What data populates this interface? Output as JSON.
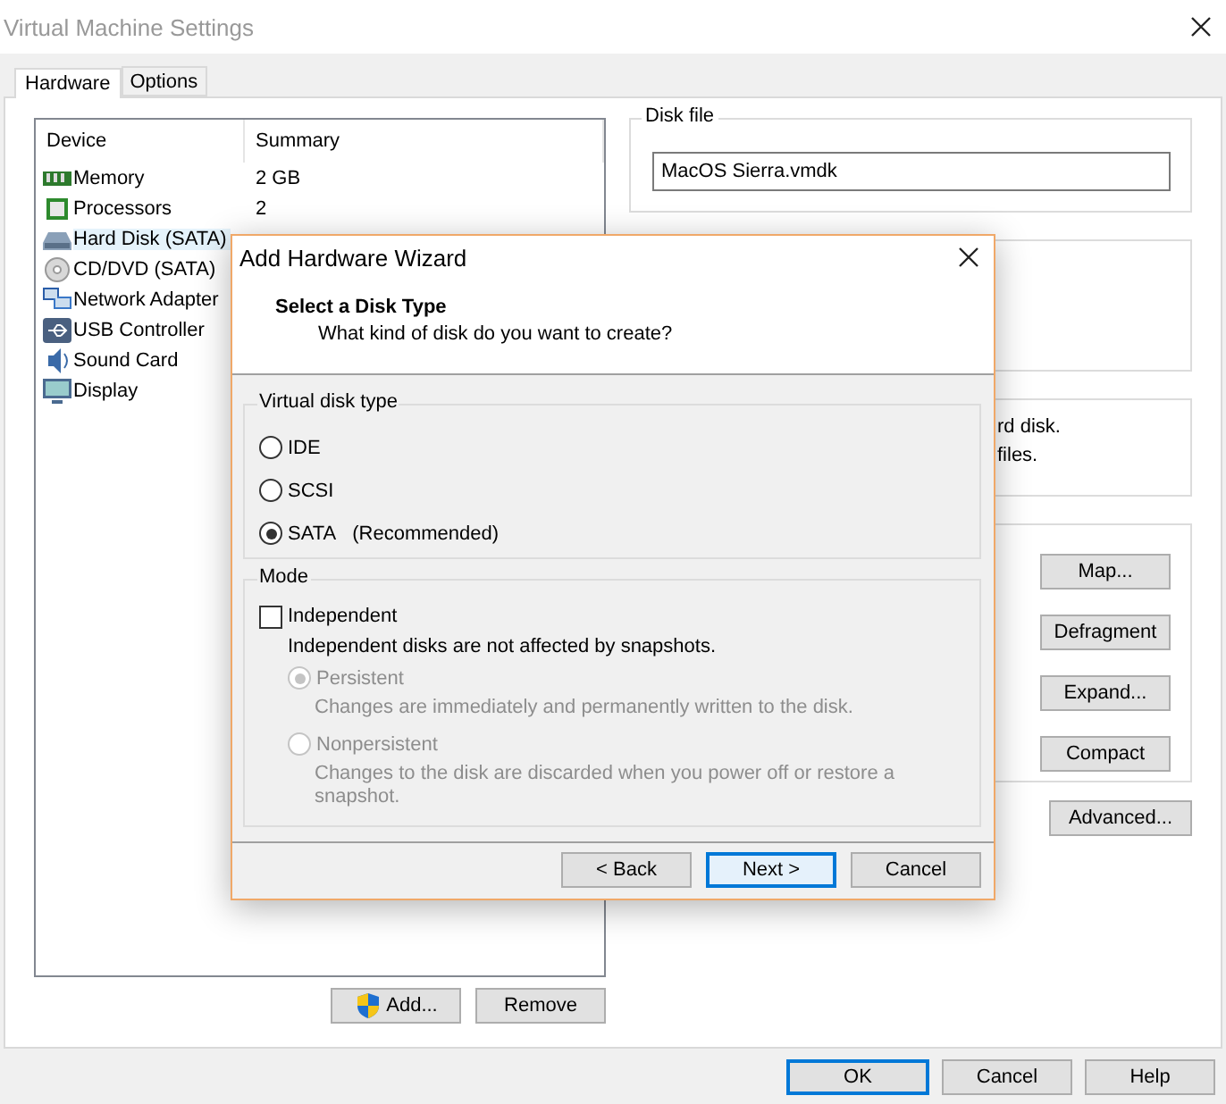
{
  "window": {
    "title": "Virtual Machine Settings"
  },
  "tabs": [
    {
      "label": "Hardware",
      "selected": true
    },
    {
      "label": "Options",
      "selected": false
    }
  ],
  "devices": {
    "columns": [
      "Device",
      "Summary"
    ],
    "rows": [
      {
        "kind": "memory",
        "name": "Memory",
        "summary": "2 GB",
        "selected": false
      },
      {
        "kind": "processor",
        "name": "Processors",
        "summary": "2",
        "selected": false
      },
      {
        "kind": "disk",
        "name": "Hard Disk (SATA)",
        "selected": true
      },
      {
        "kind": "cd",
        "name": "CD/DVD (SATA)",
        "selected": false
      },
      {
        "kind": "network",
        "name": "Network Adapter",
        "selected": false
      },
      {
        "kind": "usb",
        "name": "USB Controller",
        "selected": false
      },
      {
        "kind": "sound",
        "name": "Sound Card",
        "selected": false
      },
      {
        "kind": "display",
        "name": "Display",
        "selected": false
      }
    ]
  },
  "list_buttons": [
    {
      "label": "Add...",
      "kind": "shield"
    },
    {
      "label": "Remove",
      "kind": "plain"
    }
  ],
  "disk_file": {
    "label": "Disk file",
    "value": "MacOS Sierra.vmdk"
  },
  "info_group": {
    "lines": [
      "rd disk.",
      "files."
    ]
  },
  "utility_buttons": [
    "Map...",
    "Defragment",
    "Expand...",
    "Compact"
  ],
  "advanced_button": "Advanced...",
  "footer_buttons": [
    {
      "label": "OK",
      "default": true
    },
    {
      "label": "Cancel",
      "default": false
    },
    {
      "label": "Help",
      "default": false
    }
  ],
  "dialog": {
    "title": "Add Hardware Wizard",
    "heading": "Select a Disk Type",
    "subheading": "What kind of disk do you want to create?",
    "disk_type": {
      "legend": "Virtual disk type",
      "options": [
        {
          "label": "IDE",
          "selected": false
        },
        {
          "label": "SCSI",
          "selected": false
        },
        {
          "label": "SATA",
          "note": "(Recommended)",
          "selected": true
        }
      ]
    },
    "mode": {
      "legend": "Mode",
      "independent": {
        "label": "Independent",
        "checked": false
      },
      "note": "Independent disks are not affected by snapshots.",
      "options": [
        {
          "label": "Persistent",
          "description": "Changes are immediately and permanently written to the disk.",
          "selected": true,
          "disabled": true
        },
        {
          "label": "Nonpersistent",
          "description": "Changes to the disk are discarded when you power off or restore a snapshot.",
          "selected": false,
          "disabled": true
        }
      ]
    },
    "buttons": [
      {
        "label": "< Back",
        "default": false
      },
      {
        "label": "Next >",
        "default": true
      },
      {
        "label": "Cancel",
        "default": false
      }
    ]
  }
}
